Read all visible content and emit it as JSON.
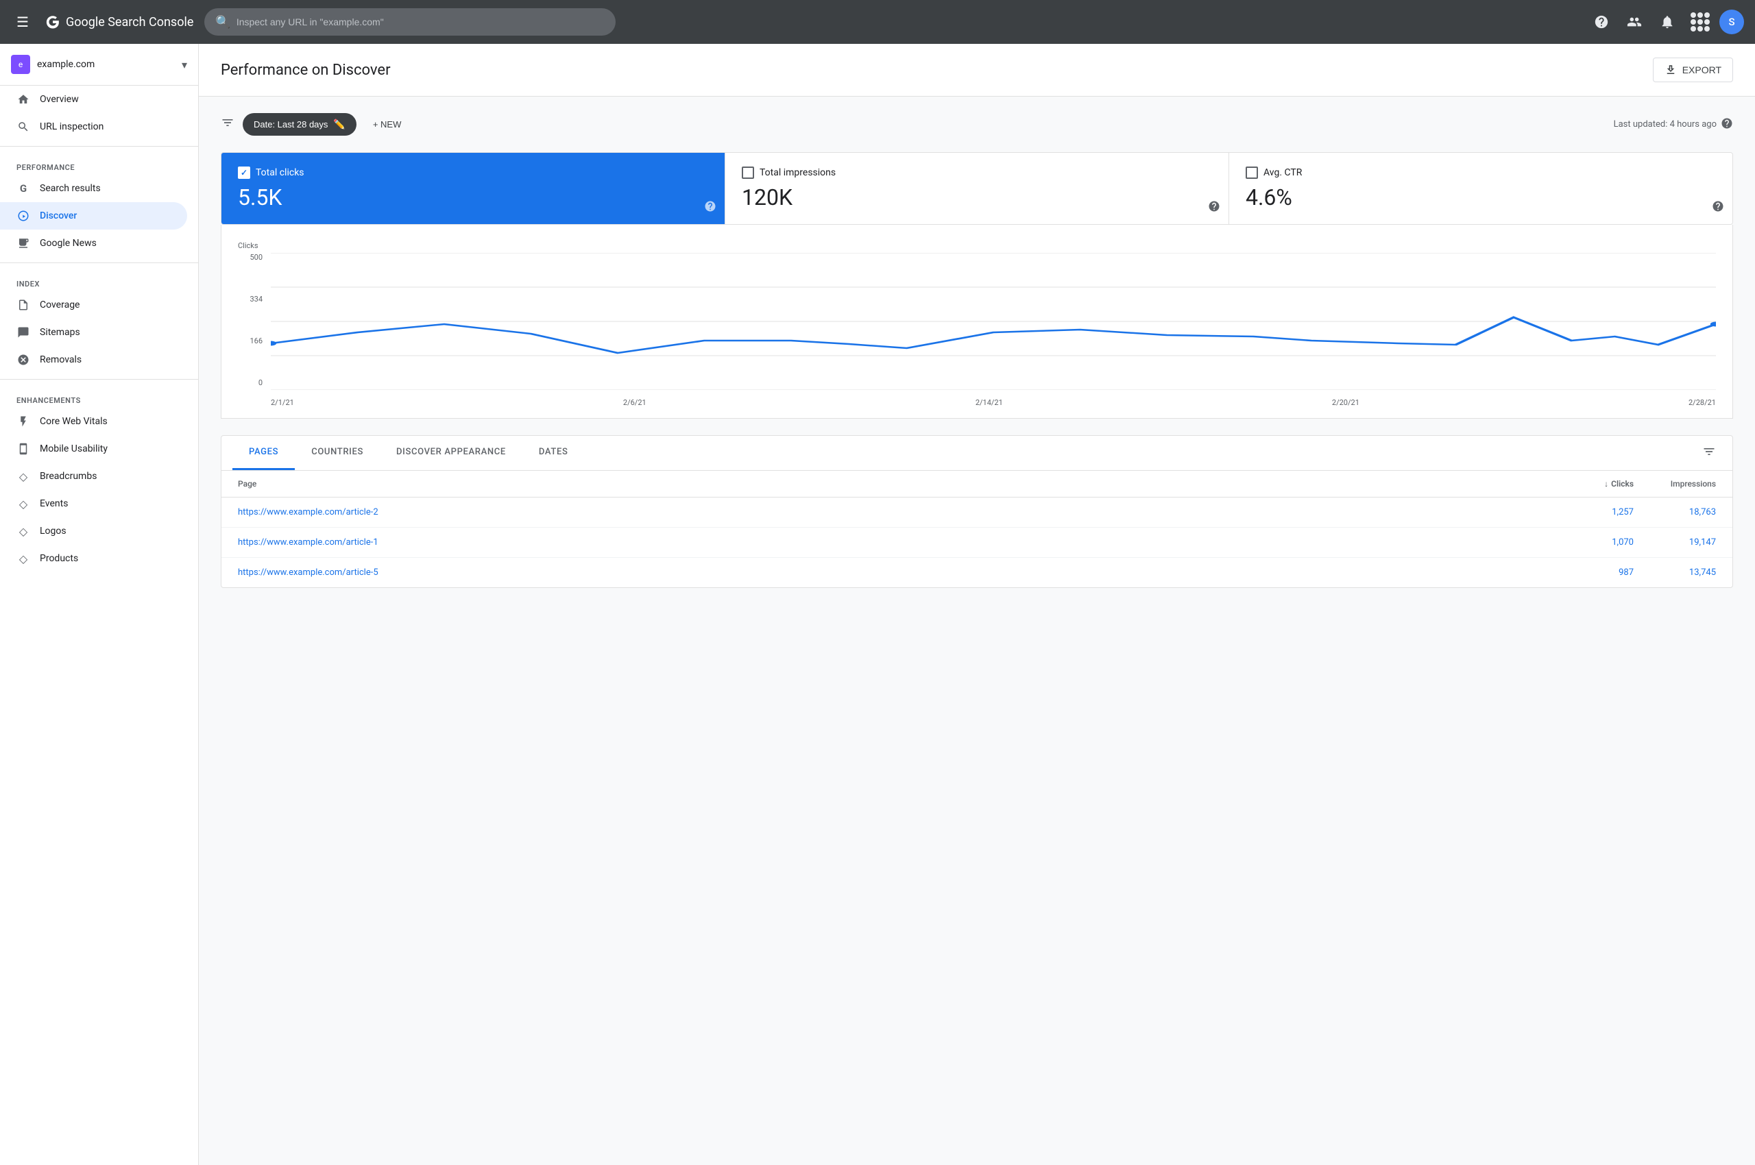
{
  "topbar": {
    "menu_icon": "☰",
    "logo_text": "Google Search Console",
    "search_placeholder": "Inspect any URL in \"example.com\"",
    "help_icon": "?",
    "avatar_letter": "S",
    "avatar_color": "#4285f4"
  },
  "sidebar": {
    "site_name": "example.com",
    "site_icon": "e",
    "nav_items": [
      {
        "id": "overview",
        "label": "Overview",
        "icon": "🏠"
      },
      {
        "id": "url-inspection",
        "label": "URL inspection",
        "icon": "🔍"
      }
    ],
    "performance_section": "Performance",
    "performance_items": [
      {
        "id": "search-results",
        "label": "Search results",
        "icon": "G"
      },
      {
        "id": "discover",
        "label": "Discover",
        "icon": "✳",
        "active": true
      },
      {
        "id": "google-news",
        "label": "Google News",
        "icon": "📰"
      }
    ],
    "index_section": "Index",
    "index_items": [
      {
        "id": "coverage",
        "label": "Coverage",
        "icon": "📄"
      },
      {
        "id": "sitemaps",
        "label": "Sitemaps",
        "icon": "🗺"
      },
      {
        "id": "removals",
        "label": "Removals",
        "icon": "🚫"
      }
    ],
    "enhancements_section": "Enhancements",
    "enhancements_items": [
      {
        "id": "core-web-vitals",
        "label": "Core Web Vitals",
        "icon": "⚡"
      },
      {
        "id": "mobile-usability",
        "label": "Mobile Usability",
        "icon": "📱"
      },
      {
        "id": "breadcrumbs",
        "label": "Breadcrumbs",
        "icon": "◇"
      },
      {
        "id": "events",
        "label": "Events",
        "icon": "◇"
      },
      {
        "id": "logos",
        "label": "Logos",
        "icon": "◇"
      },
      {
        "id": "products",
        "label": "Products",
        "icon": "◇"
      }
    ]
  },
  "header": {
    "title": "Performance on Discover",
    "export_label": "EXPORT"
  },
  "filter_bar": {
    "date_filter_label": "Date: Last 28 days",
    "new_label": "+ NEW",
    "last_updated": "Last updated: 4 hours ago"
  },
  "metrics": [
    {
      "id": "total-clicks",
      "label": "Total clicks",
      "value": "5.5K",
      "active": true
    },
    {
      "id": "total-impressions",
      "label": "Total impressions",
      "value": "120K",
      "active": false
    },
    {
      "id": "avg-ctr",
      "label": "Avg. CTR",
      "value": "4.6%",
      "active": false
    }
  ],
  "chart": {
    "y_label": "Clicks",
    "y_ticks": [
      "500",
      "334",
      "166",
      "0"
    ],
    "x_ticks": [
      "2/1/21",
      "2/6/21",
      "2/14/21",
      "2/20/21",
      "2/28/21"
    ],
    "data_points": [
      {
        "x": 0,
        "y": 170
      },
      {
        "x": 0.06,
        "y": 210
      },
      {
        "x": 0.12,
        "y": 240
      },
      {
        "x": 0.18,
        "y": 205
      },
      {
        "x": 0.24,
        "y": 135
      },
      {
        "x": 0.3,
        "y": 175
      },
      {
        "x": 0.36,
        "y": 175
      },
      {
        "x": 0.4,
        "y": 165
      },
      {
        "x": 0.44,
        "y": 152
      },
      {
        "x": 0.5,
        "y": 210
      },
      {
        "x": 0.56,
        "y": 220
      },
      {
        "x": 0.62,
        "y": 200
      },
      {
        "x": 0.68,
        "y": 195
      },
      {
        "x": 0.72,
        "y": 175
      },
      {
        "x": 0.78,
        "y": 170
      },
      {
        "x": 0.82,
        "y": 165
      },
      {
        "x": 0.86,
        "y": 265
      },
      {
        "x": 0.9,
        "y": 175
      },
      {
        "x": 0.93,
        "y": 190
      },
      {
        "x": 0.96,
        "y": 165
      },
      {
        "x": 1.0,
        "y": 240
      }
    ]
  },
  "tabs": {
    "items": [
      {
        "id": "pages",
        "label": "PAGES",
        "active": true
      },
      {
        "id": "countries",
        "label": "COUNTRIES",
        "active": false
      },
      {
        "id": "discover-appearance",
        "label": "DISCOVER APPEARANCE",
        "active": false
      },
      {
        "id": "dates",
        "label": "DATES",
        "active": false
      }
    ]
  },
  "table": {
    "columns": {
      "page": "Page",
      "clicks": "Clicks",
      "impressions": "Impressions"
    },
    "rows": [
      {
        "url": "https://www.example.com/article-2",
        "clicks": "1,257",
        "impressions": "18,763"
      },
      {
        "url": "https://www.example.com/article-1",
        "clicks": "1,070",
        "impressions": "19,147"
      },
      {
        "url": "https://www.example.com/article-5",
        "clicks": "987",
        "impressions": "13,745"
      }
    ]
  }
}
